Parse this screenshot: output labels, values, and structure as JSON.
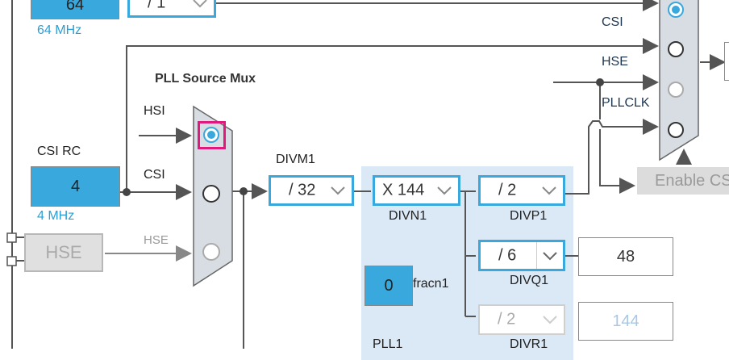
{
  "top": {
    "value": "64",
    "freq": "64 MHz",
    "divider": "/ 1"
  },
  "sys_mux": {
    "inputs": [
      "CSI",
      "HSE",
      "PLLCLK"
    ],
    "enable_button": "Enable CS"
  },
  "pll_source_mux": {
    "title": "PLL Source Mux",
    "inputs": [
      "HSI",
      "CSI",
      "HSE"
    ],
    "selected": "HSI"
  },
  "csi_rc": {
    "label": "CSI RC",
    "value": "4",
    "freq": "4 MHz"
  },
  "hse": {
    "label": "HSE"
  },
  "divm1": {
    "label": "DIVM1",
    "value": "/ 32"
  },
  "pll1": {
    "divn1": {
      "label": "DIVN1",
      "value": "X 144"
    },
    "divp1": {
      "label": "DIVP1",
      "value": "/ 2"
    },
    "divq1": {
      "label": "DIVQ1",
      "value": "/ 6",
      "output": "48"
    },
    "divr1": {
      "label": "DIVR1",
      "value": "/ 2",
      "output": "144"
    },
    "fracn1": {
      "label": "fracn1",
      "value": "0"
    },
    "label": "PLL1"
  },
  "colors": {
    "accent": "#39a8dd",
    "selection_highlight": "#e0197d",
    "pll_panel": "#dbe8f5",
    "disabled": "#dcdcdc"
  }
}
